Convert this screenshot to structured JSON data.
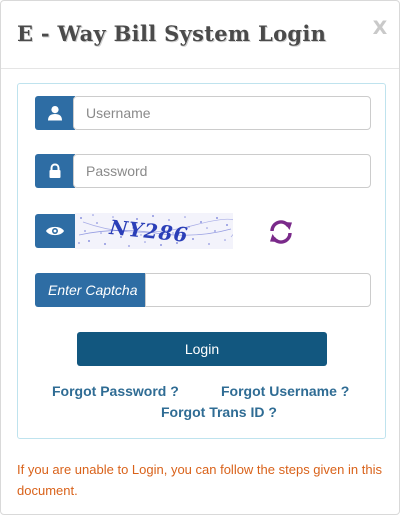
{
  "header": {
    "title": "E - Way Bill System Login",
    "close_label": "X"
  },
  "form": {
    "username": {
      "placeholder": "Username",
      "value": ""
    },
    "password": {
      "placeholder": "Password",
      "value": ""
    },
    "captcha": {
      "image_text": "NY286",
      "label": "Enter Captcha",
      "value": ""
    },
    "login_label": "Login"
  },
  "links": {
    "forgot_password": "Forgot Password ?",
    "forgot_username": "Forgot Username ?",
    "forgot_trans_id": "Forgot Trans ID ?"
  },
  "note": "If you are unable to Login, you can follow the steps given in this document.",
  "colors": {
    "addon_blue": "#2e6da4",
    "button_blue": "#12577f",
    "link_blue": "#2f6c94",
    "note_orange": "#d9621a",
    "refresh_purple": "#7a2a8a",
    "captcha_blue": "#2b3fb8"
  },
  "icons": {
    "username": "user-icon",
    "password": "lock-icon",
    "captcha": "eye-icon",
    "refresh": "refresh-icon"
  }
}
